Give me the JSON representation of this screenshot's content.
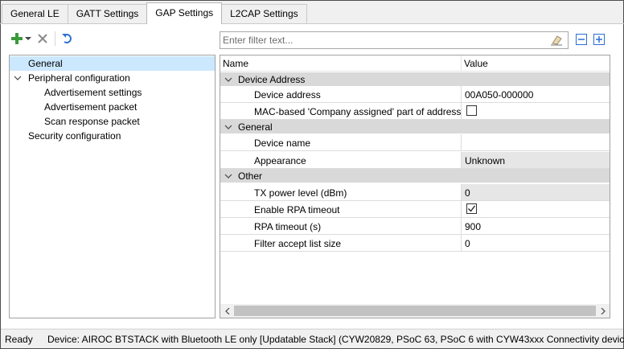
{
  "tabs": [
    {
      "label": "General LE"
    },
    {
      "label": "GATT Settings"
    },
    {
      "label": "GAP Settings"
    },
    {
      "label": "L2CAP Settings"
    }
  ],
  "active_tab": "GAP Settings",
  "toolbar": {
    "icons": [
      "add-icon",
      "dropdown-arrow-icon",
      "delete-icon",
      "undo-icon"
    ]
  },
  "filter": {
    "placeholder": "Enter filter text..."
  },
  "tree": [
    {
      "label": "General",
      "selected": true
    },
    {
      "label": "Peripheral configuration",
      "expanded": true
    },
    {
      "label": "Advertisement settings"
    },
    {
      "label": "Advertisement packet"
    },
    {
      "label": "Scan response packet"
    },
    {
      "label": "Security configuration"
    }
  ],
  "grid": {
    "columns": {
      "name": "Name",
      "value": "Value"
    },
    "categories": [
      {
        "label": "Device Address",
        "rows": [
          {
            "name": "Device address",
            "value": "00A050-000000"
          },
          {
            "name": "MAC-based 'Company assigned' part of address",
            "value": "",
            "checkbox": true,
            "checked": false
          }
        ]
      },
      {
        "label": "General",
        "rows": [
          {
            "name": "Device name",
            "value": ""
          },
          {
            "name": "Appearance",
            "value": "Unknown",
            "readonly": true
          }
        ]
      },
      {
        "label": "Other",
        "rows": [
          {
            "name": "TX power level (dBm)",
            "value": "0",
            "readonly": true
          },
          {
            "name": "Enable RPA timeout",
            "value": "",
            "checkbox": true,
            "checked": true
          },
          {
            "name": "RPA timeout (s)",
            "value": "900"
          },
          {
            "name": "Filter accept list size",
            "value": "0"
          }
        ]
      }
    ]
  },
  "status": {
    "state": "Ready",
    "device": "Device: AIROC BTSTACK with Bluetooth LE only [Updatable Stack] (CYW20829, PSoC 63, PSoC 6 with CYW43xxx Connectivity device)"
  },
  "colors": {
    "selection": "#cce8ff",
    "category_band": "#d9d9d9",
    "readonly_value": "#e6e6e6",
    "add_icon": "#3a9a3a",
    "undo_icon": "#2a6fd4"
  }
}
